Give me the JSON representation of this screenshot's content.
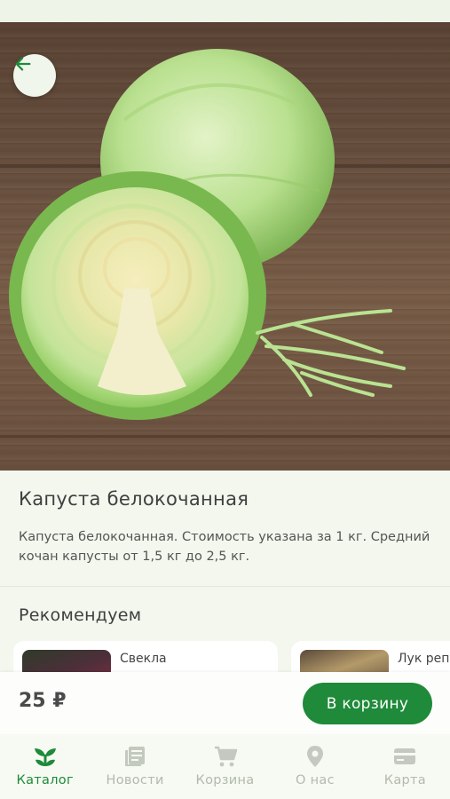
{
  "product": {
    "title": "Капуста белокочанная",
    "description": "Капуста белокочанная. Стоимость указана за 1 кг. Средний кочан капусты от 1,5 кг до 2,5 кг.",
    "price": "25 ₽",
    "add_to_cart_label": "В корзину"
  },
  "recommendations": {
    "title": "Рекомендуем",
    "items": [
      {
        "name": "Свекла"
      },
      {
        "name": "Лук репчатый"
      }
    ]
  },
  "nav": {
    "items": [
      {
        "label": "Каталог",
        "icon": "sprout-icon",
        "active": true
      },
      {
        "label": "Новости",
        "icon": "news-icon",
        "active": false
      },
      {
        "label": "Корзина",
        "icon": "cart-icon",
        "active": false
      },
      {
        "label": "О нас",
        "icon": "location-pin-icon",
        "active": false
      },
      {
        "label": "Карта",
        "icon": "card-icon",
        "active": false
      }
    ]
  },
  "colors": {
    "accent": "#1f8a3a",
    "inactive": "#b3b9ae",
    "background": "#f3f7ee"
  }
}
